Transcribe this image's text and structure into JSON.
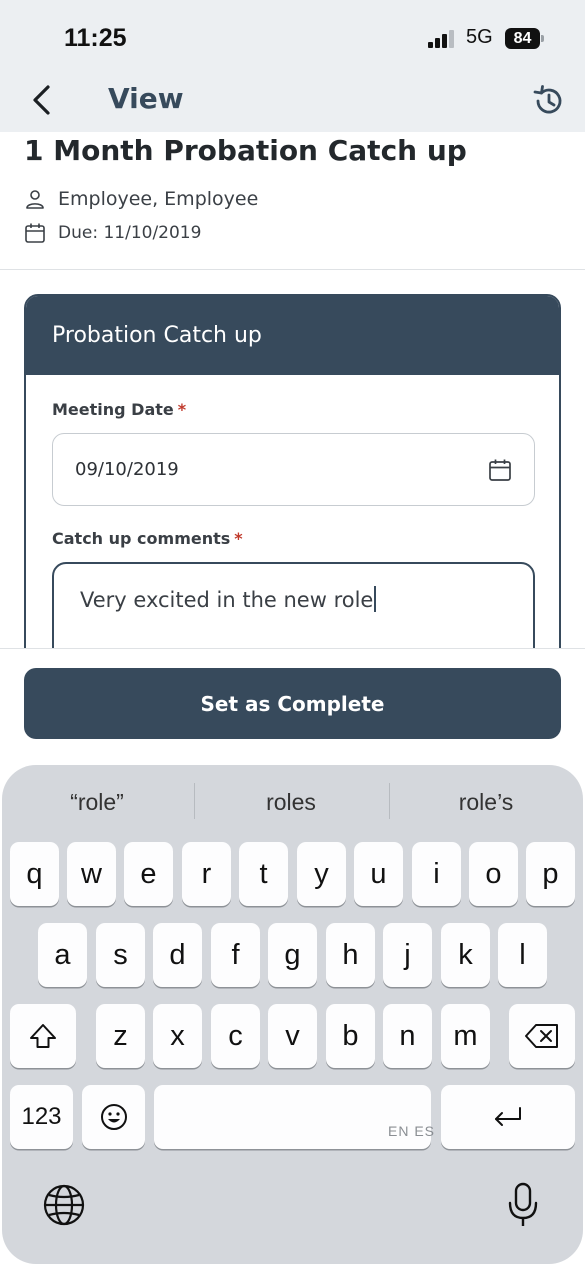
{
  "status_bar": {
    "time": "11:25",
    "network": "5G",
    "battery": "84"
  },
  "nav": {
    "title": "View",
    "back_icon": "chevron-left-icon",
    "history_icon": "history-icon"
  },
  "header": {
    "title": "1 Month Probation Catch up",
    "assignee": "Employee, Employee",
    "due": "Due: 11/10/2019"
  },
  "card": {
    "title": "Probation Catch up",
    "meeting_date_label": "Meeting Date",
    "meeting_date_value": "09/10/2019",
    "comments_label": "Catch up comments",
    "comments_value": "Very excited in the new role",
    "required_mark": "*"
  },
  "actions": {
    "complete_label": "Set as Complete"
  },
  "keyboard": {
    "suggestions": [
      "“role”",
      "roles",
      "role’s"
    ],
    "row1": [
      "q",
      "w",
      "e",
      "r",
      "t",
      "y",
      "u",
      "i",
      "o",
      "p"
    ],
    "row2": [
      "a",
      "s",
      "d",
      "f",
      "g",
      "h",
      "j",
      "k",
      "l"
    ],
    "row3": [
      "z",
      "x",
      "c",
      "v",
      "b",
      "n",
      "m"
    ],
    "numbers_label": "123",
    "space_sublabel": "EN ES"
  },
  "colors": {
    "primary": "#374a5c",
    "required": "#c0392b",
    "keyboard_bg": "#d4d7dc"
  }
}
